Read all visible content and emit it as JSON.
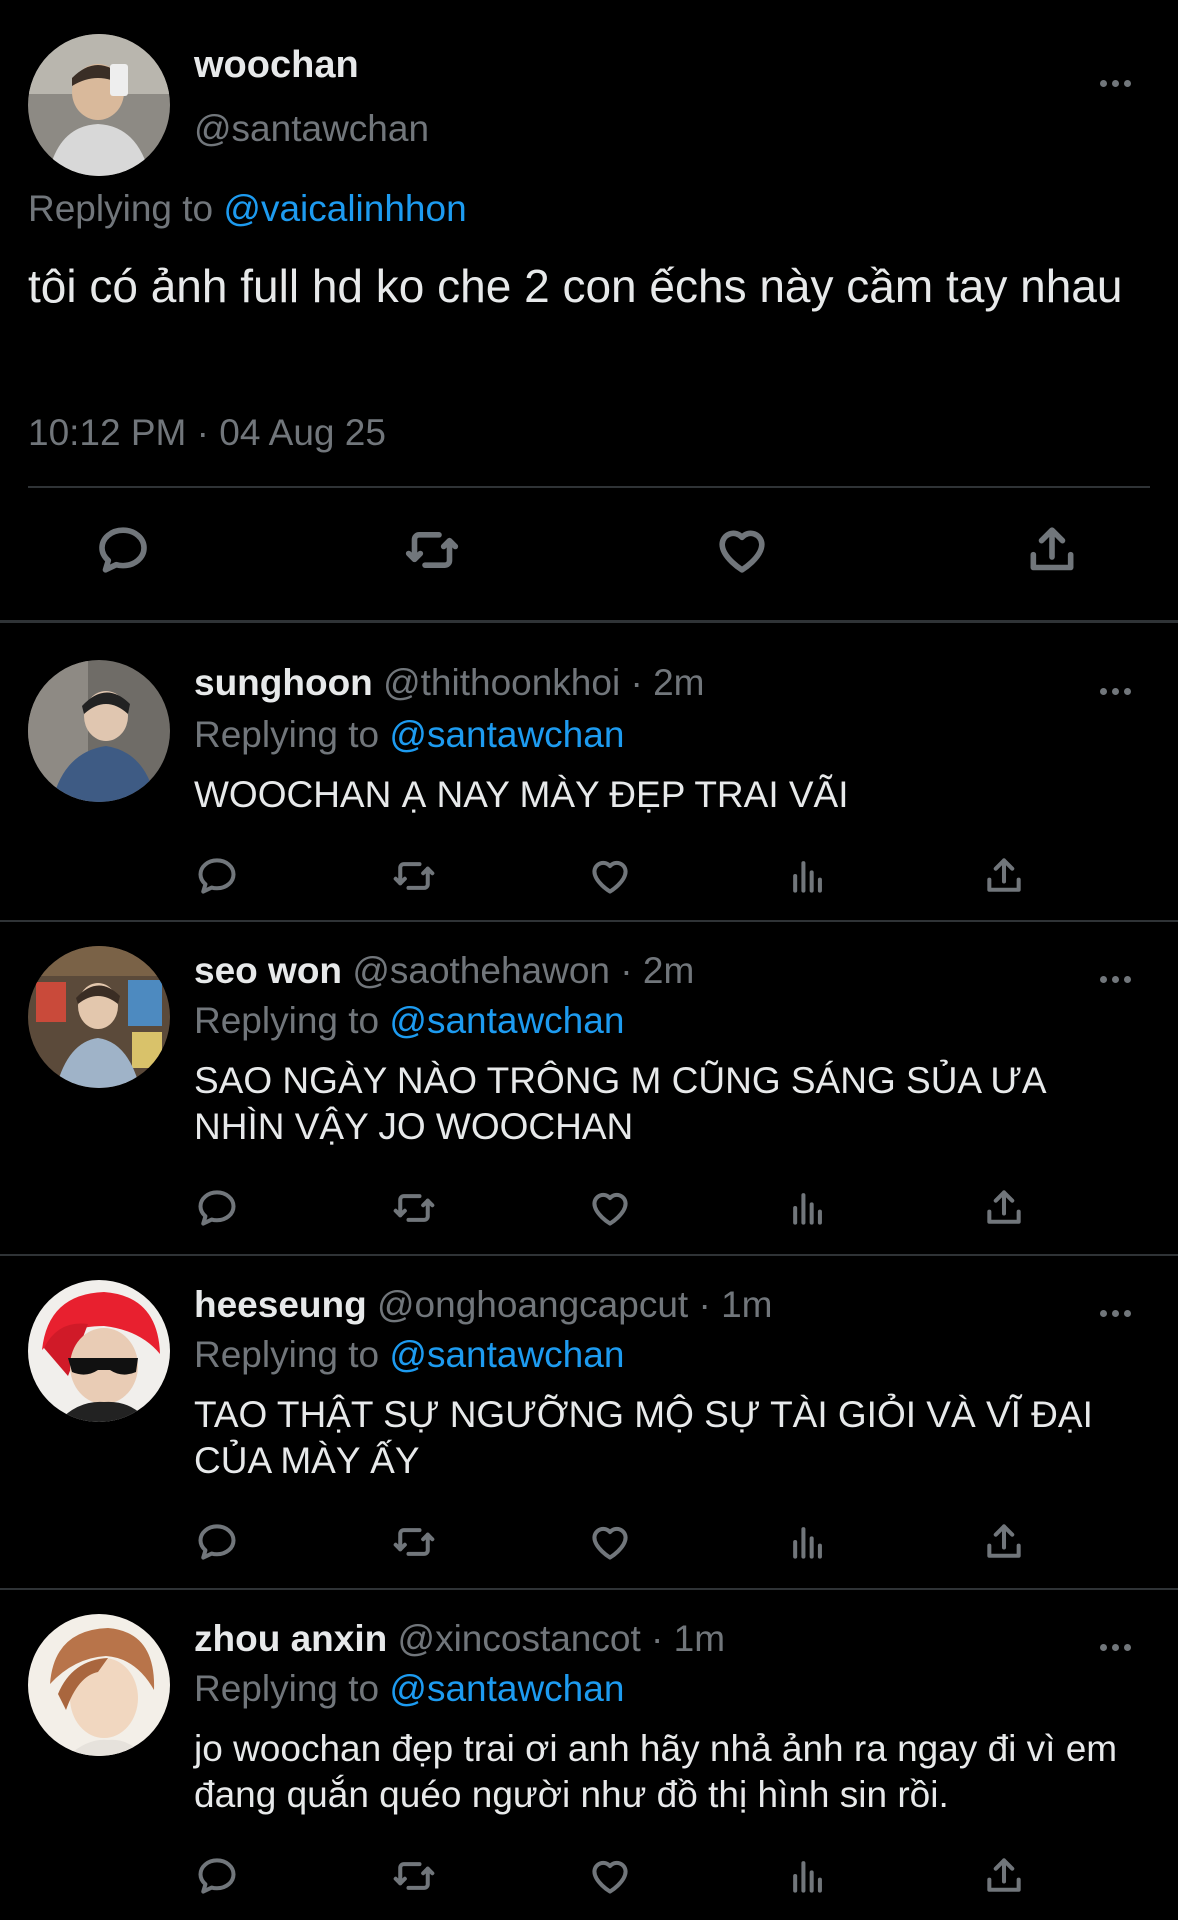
{
  "main_tweet": {
    "name": "woochan",
    "handle": "@santawchan",
    "replying_prefix": "Replying to ",
    "replying_to": "@vaicalinhhon",
    "text": "tôi có ảnh full hd ko che 2 con ếchs này cầm tay nhau",
    "timestamp": "10:12 PM · 04 Aug 25",
    "icons": [
      "reply-icon",
      "retweet-icon",
      "like-icon",
      "share-icon",
      "more-icon"
    ]
  },
  "replies": [
    {
      "name": "sunghoon",
      "handle": "@thithoonkhoi",
      "time": "· 2m",
      "replying_prefix": "Replying to ",
      "replying_to": "@santawchan",
      "text": "WOOCHAN Ạ NAY MÀY ĐẸP TRAI VÃI"
    },
    {
      "name": "seo won",
      "handle": "@saothehawon",
      "time": "· 2m",
      "replying_prefix": "Replying to ",
      "replying_to": "@santawchan",
      "text": "SAO NGÀY NÀO TRÔNG M CŨNG SÁNG SỦA ƯA NHÌN VẬY JO WOOCHAN"
    },
    {
      "name": "heeseung",
      "handle": "@onghoangcapcut",
      "time": "· 1m",
      "replying_prefix": "Replying to ",
      "replying_to": "@santawchan",
      "text": "TAO THẬT SỰ NGƯỠNG MỘ SỰ TÀI GIỎI VÀ VĨ ĐẠI CỦA MÀY ẤY"
    },
    {
      "name": "zhou anxin",
      "handle": "@xincostancot",
      "time": "· 1m",
      "replying_prefix": "Replying to ",
      "replying_to": "@santawchan",
      "text": "jo woochan đẹp trai ơi anh hãy nhả ảnh ra ngay đi vì em đang quắn quéo người như đồ thị hình sin rồi."
    }
  ],
  "colors": {
    "background": "#000000",
    "text": "#e7e9ea",
    "muted": "#71767b",
    "link": "#1d9bf0",
    "divider": "#2f3336"
  }
}
